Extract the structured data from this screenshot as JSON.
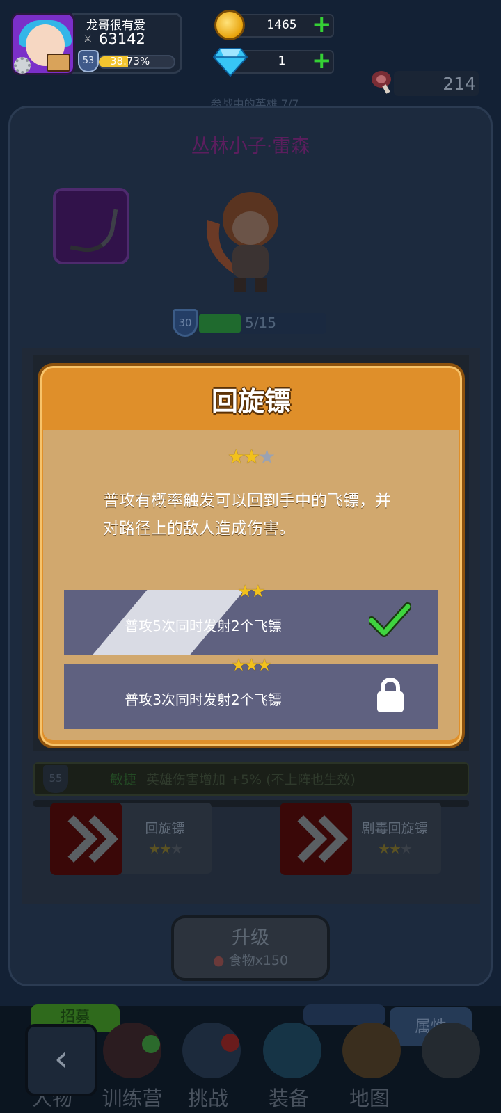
{
  "player": {
    "name": "龙哥很有爱",
    "power": "63142",
    "level": "53",
    "xp_percent": "38.73%",
    "xp_fraction": 0.3873
  },
  "resources": {
    "gold": "1465",
    "gems": "1",
    "food": "214"
  },
  "section_title": "参战中的英雄      7/7",
  "hero": {
    "name": "丛林小子·雷森",
    "level": "30",
    "progress_text": "5/15",
    "progress_fraction": 0.3333
  },
  "trait": {
    "level": "55",
    "name": "敏捷",
    "description": "英雄伤害增加 +5% (不上阵也生效)"
  },
  "skill_cards": [
    {
      "label": "回旋镖",
      "stars": 2,
      "max_stars": 3
    },
    {
      "label": "剧毒回旋镖",
      "stars": 2,
      "max_stars": 3
    }
  ],
  "upgrade": {
    "label": "升级",
    "cost": "食物x150"
  },
  "tabs": {
    "chop": "招募",
    "attributes": "属性"
  },
  "nav": [
    {
      "label": "人物",
      "icon": "character-icon"
    },
    {
      "label": "训练营",
      "icon": "target-icon"
    },
    {
      "label": "挑战",
      "icon": "sword-icon"
    },
    {
      "label": "装备",
      "icon": "armor-icon"
    },
    {
      "label": "地图",
      "icon": "map-icon"
    },
    {
      "label": "",
      "icon": "locked-icon"
    }
  ],
  "dialog": {
    "title": "回旋镖",
    "stars": 2,
    "max_stars": 3,
    "description": "普攻有概率触发可以回到手中的飞镖，并对路径上的敌人造成伤害。",
    "tiers": [
      {
        "stars": 2,
        "text": "普攻5次同时发射2个飞镖",
        "unlocked": true,
        "icon": "check-icon"
      },
      {
        "stars": 3,
        "text": "普攻3次同时发射2个飞镖",
        "unlocked": false,
        "icon": "lock-icon"
      }
    ]
  },
  "colors": {
    "dialog_orange": "#df8f2a",
    "dialog_body": "#d1a86e",
    "tier_box": "#5f6180",
    "star_gold": "#f2c11c",
    "plus_green": "#35d135",
    "check_green": "#3fd43f"
  }
}
